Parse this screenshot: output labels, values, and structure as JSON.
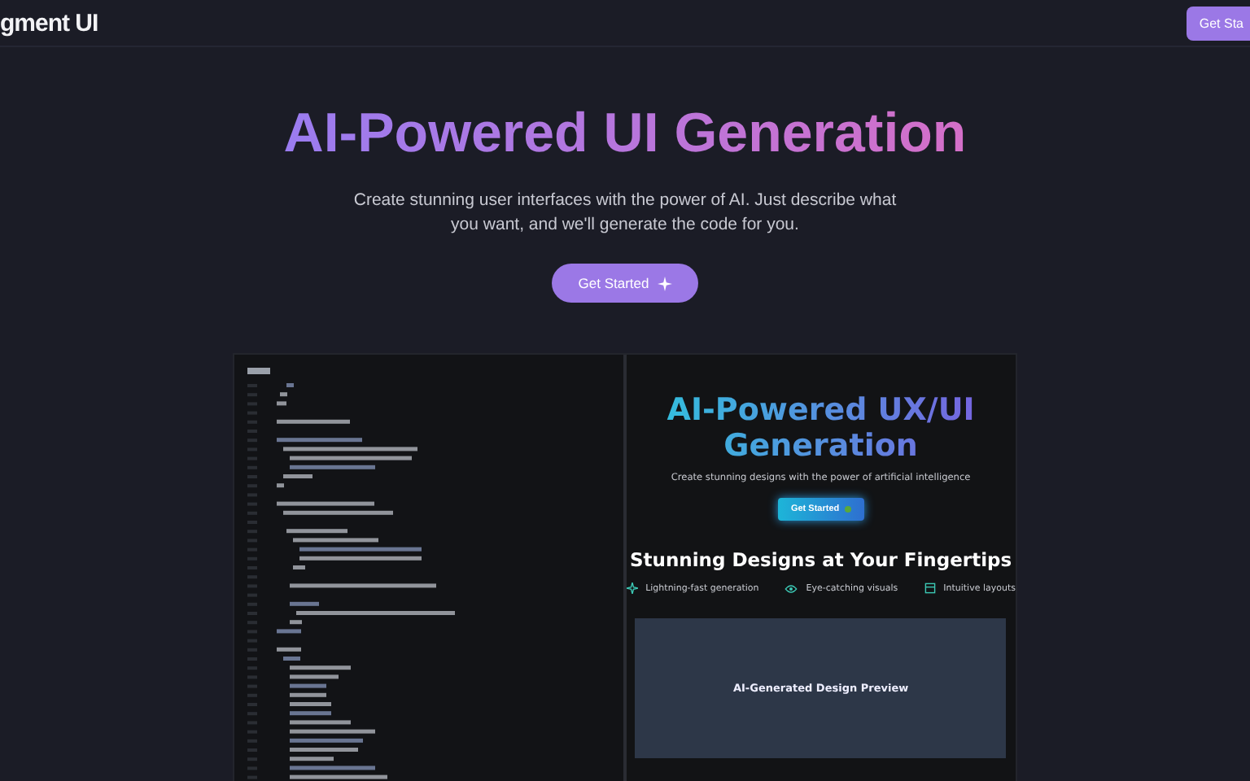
{
  "navbar": {
    "logo": "gment UI",
    "button": "Get Sta"
  },
  "hero": {
    "title": "AI-Powered UI Generation",
    "subtitle": "Create stunning user interfaces with the power of AI. Just describe what you want, and we'll generate the code for you.",
    "button": "Get Started"
  },
  "preview": {
    "title": "AI-Powered UX/UI Generation",
    "subtitle": "Create stunning designs with the power of artificial intelligence",
    "button": "Get Started",
    "heading": "Stunning Designs at Your Fingertips",
    "features": [
      {
        "kind": "sparkle",
        "label": "Lightning-fast generation"
      },
      {
        "kind": "eye",
        "label": "Eye-catching visuals"
      },
      {
        "kind": "layout",
        "label": "Intuitive layouts"
      }
    ],
    "design_preview": "AI-Generated Design Preview"
  }
}
